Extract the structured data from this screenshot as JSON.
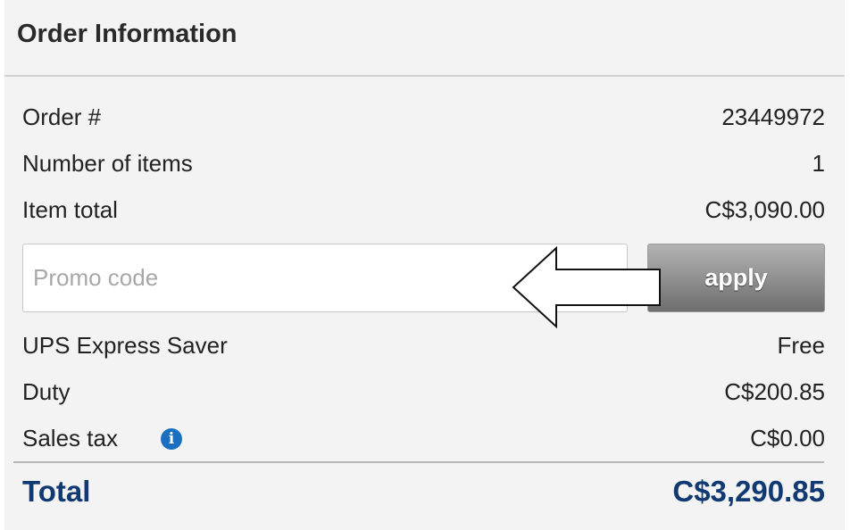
{
  "header": {
    "title": "Order Information"
  },
  "rows": [
    {
      "label": "Order #",
      "value": "23449972"
    },
    {
      "label": "Number of items",
      "value": "1"
    },
    {
      "label": "Item total",
      "value": "C$3,090.00"
    }
  ],
  "promo": {
    "placeholder": "Promo code",
    "value": "",
    "apply_label": "apply"
  },
  "rows2": [
    {
      "label": "UPS Express Saver",
      "value": "Free"
    },
    {
      "label": "Duty",
      "value": "C$200.85"
    },
    {
      "label": "Sales tax",
      "value": "C$0.00",
      "icon": "info-icon"
    }
  ],
  "total": {
    "label": "Total",
    "value": "C$3,290.85"
  },
  "colors": {
    "total_text": "#123a72",
    "info_icon": "#1a6fc1",
    "panel_bg": "#f3f3f3"
  }
}
